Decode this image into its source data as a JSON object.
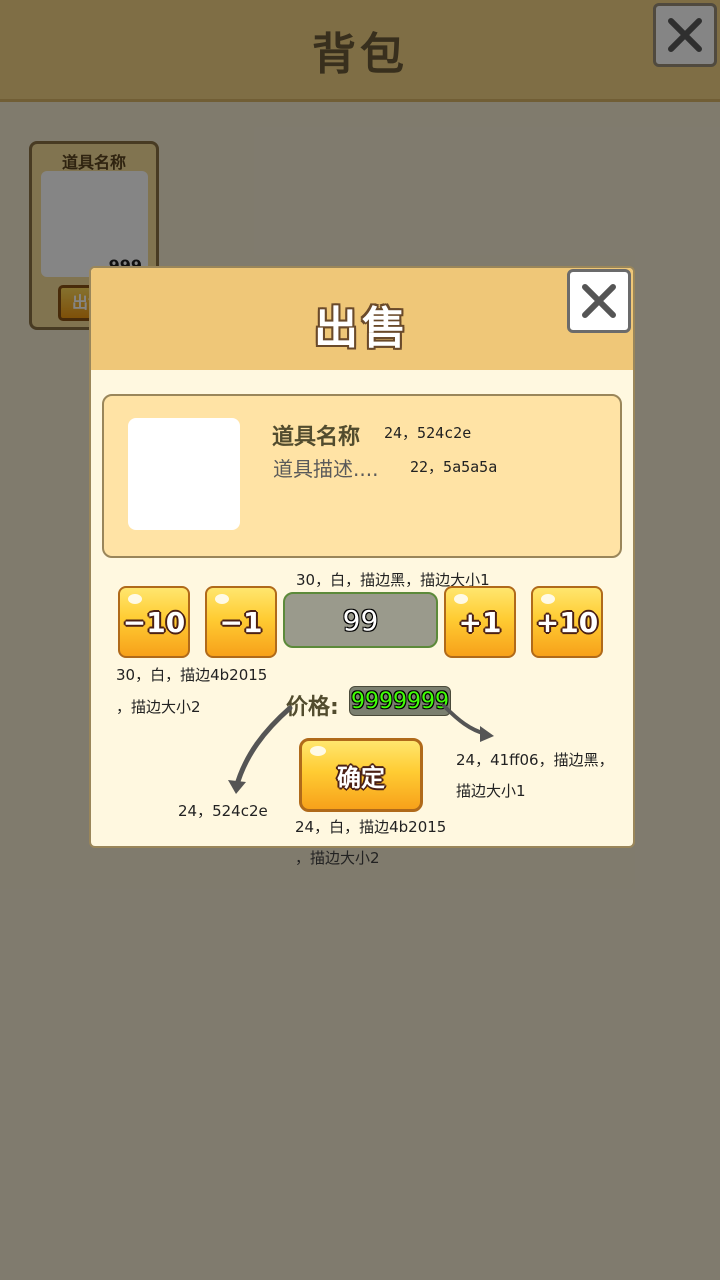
{
  "background": {
    "header_title": "背包",
    "close_icon": "close-icon",
    "item_card": {
      "name": "道具名称",
      "count": "999",
      "button_label": "出售"
    }
  },
  "dialog": {
    "title": "出售",
    "close_icon": "close-icon",
    "item": {
      "name": "道具名称",
      "name_note": "24，524c2e",
      "description": "道具描述....",
      "description_note": "22，5a5a5a"
    },
    "stepper": {
      "minus10": "−10",
      "minus1": "−1",
      "quantity": "99",
      "plus1": "+1",
      "plus10": "+10",
      "quantity_note": "30，白，描边黑，描边大小1",
      "button_note_line1": "30，白，描边4b2015",
      "button_note_line2": "，描边大小2"
    },
    "price": {
      "label": "价格:",
      "value": "9999999",
      "label_note": "24，524c2e",
      "value_note_line1": "24，41ff06，描边黑，",
      "value_note_line2": "描边大小1"
    },
    "confirm": {
      "label": "确定",
      "note_line1": "24，白，描边4b2015",
      "note_line2": "，描边大小2"
    }
  },
  "colors": {
    "header_bg": "#f3d485",
    "dialog_header_bg": "#efc778",
    "dialog_body_bg": "#fff8e0",
    "item_panel_bg": "#ffe3a5",
    "name_color": "#524c2e",
    "desc_color": "#5a5a5a",
    "price_green": "#41ff06",
    "stroke_brown": "#4b2015"
  }
}
